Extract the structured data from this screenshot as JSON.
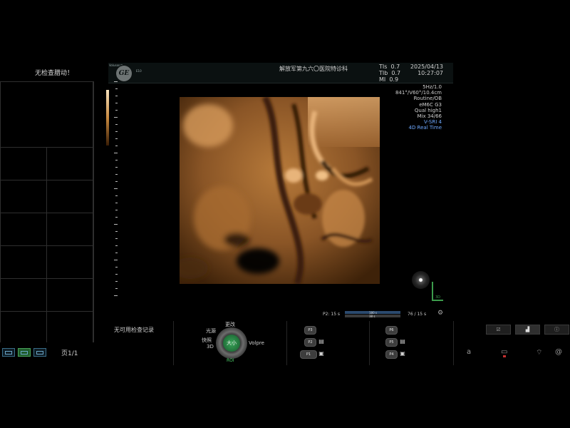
{
  "left_panel": {
    "title": "无检查腊动！",
    "page": "页1/1",
    "layout_buttons": [
      "layout-2x1",
      "layout-2x2",
      "layout-3x3"
    ]
  },
  "header": {
    "brand": "Voluson™",
    "brand_model": "E10",
    "logo": "GE",
    "hospital": "解放军第九六〇医院特诊科",
    "indices": [
      {
        "label": "TIs",
        "value": "0.7"
      },
      {
        "label": "TIb",
        "value": "0.7"
      },
      {
        "label": "MI",
        "value": "0.9"
      }
    ],
    "date": "2025/04/13",
    "time": "10:27:07"
  },
  "params": [
    "5Hz/1.0",
    "841°/V60°/10.4cm",
    "Routine/OB",
    "eM6C G3",
    "Qual high1",
    "Mix 34/66"
  ],
  "params_blue": [
    "V-SRI 4",
    "4D Real Time"
  ],
  "orientation_label": "3D",
  "cine": {
    "left_label": "P2:",
    "left_value": "15 s",
    "mid_top": "180 s",
    "mid_bottom": "38 s",
    "right": "76 / 15 s"
  },
  "bottom": {
    "no_record": "无可用检查记录",
    "knob": {
      "top": "更改",
      "upper_left": "光源",
      "left_top": "快照",
      "left_bottom": "3D",
      "right": "Volpre",
      "center": "大小",
      "bottom": "ROI"
    },
    "presets_left": [
      "P3",
      "P2",
      "P1"
    ],
    "presets_right": [
      "P6",
      "P5",
      "P4"
    ],
    "right_tabs": [
      "checklist-icon",
      "chart-icon",
      "info-icon"
    ],
    "bottom_icons": [
      "text-icon",
      "trackball-icon",
      "wifi-icon",
      "at-icon"
    ],
    "text_icon_label": "a",
    "at_icon_label": "@"
  },
  "colors": {
    "background": "#000000",
    "image_tint": "#c98a40",
    "accent_green": "#3aa55a",
    "accent_blue": "#6ea8ff"
  }
}
